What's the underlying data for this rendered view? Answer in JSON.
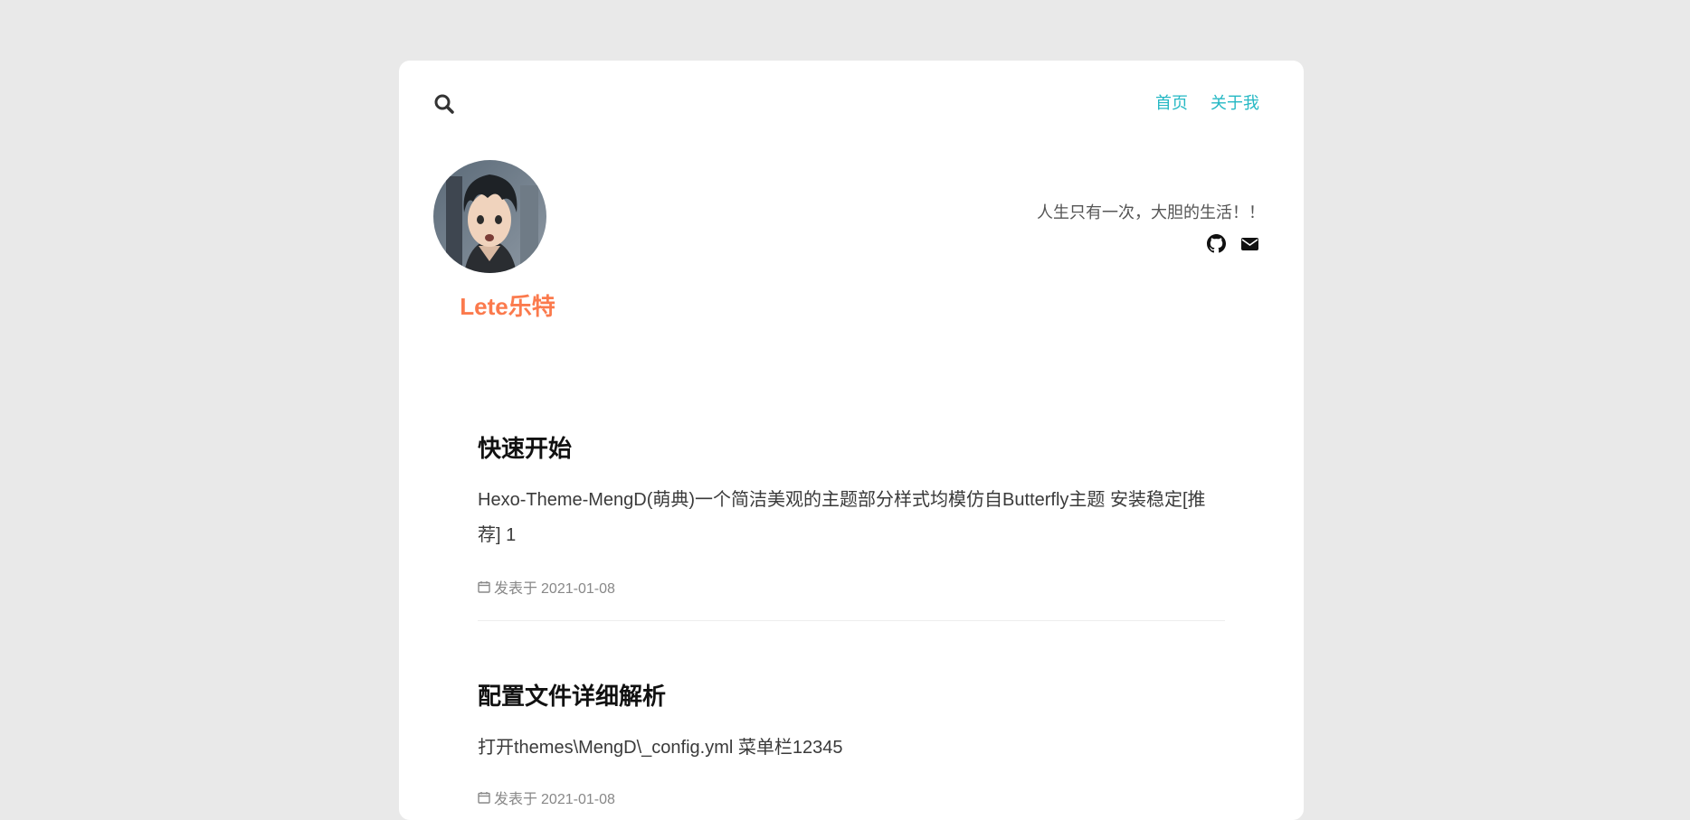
{
  "header": {
    "search_icon": "search-icon",
    "nav": [
      {
        "label": "首页"
      },
      {
        "label": "关于我"
      }
    ],
    "accent_color": "#25b8c4"
  },
  "profile": {
    "author_name": "Lete乐特",
    "author_color": "#fb7a4d",
    "motto": "人生只有一次，大胆的生活！！",
    "social_icons": [
      "github-icon",
      "envelope-icon"
    ]
  },
  "posts": [
    {
      "title": "快速开始",
      "excerpt": "Hexo-Theme-MengD(萌典)一个简洁美观的主题部分样式均模仿自Butterfly主题 安装稳定[推荐] 1",
      "meta_label": "发表于",
      "date": "2021-01-08"
    },
    {
      "title": "配置文件详细解析",
      "excerpt": "打开themes\\MengD\\_config.yml 菜单栏12345",
      "meta_label": "发表于",
      "date": "2021-01-08"
    }
  ]
}
